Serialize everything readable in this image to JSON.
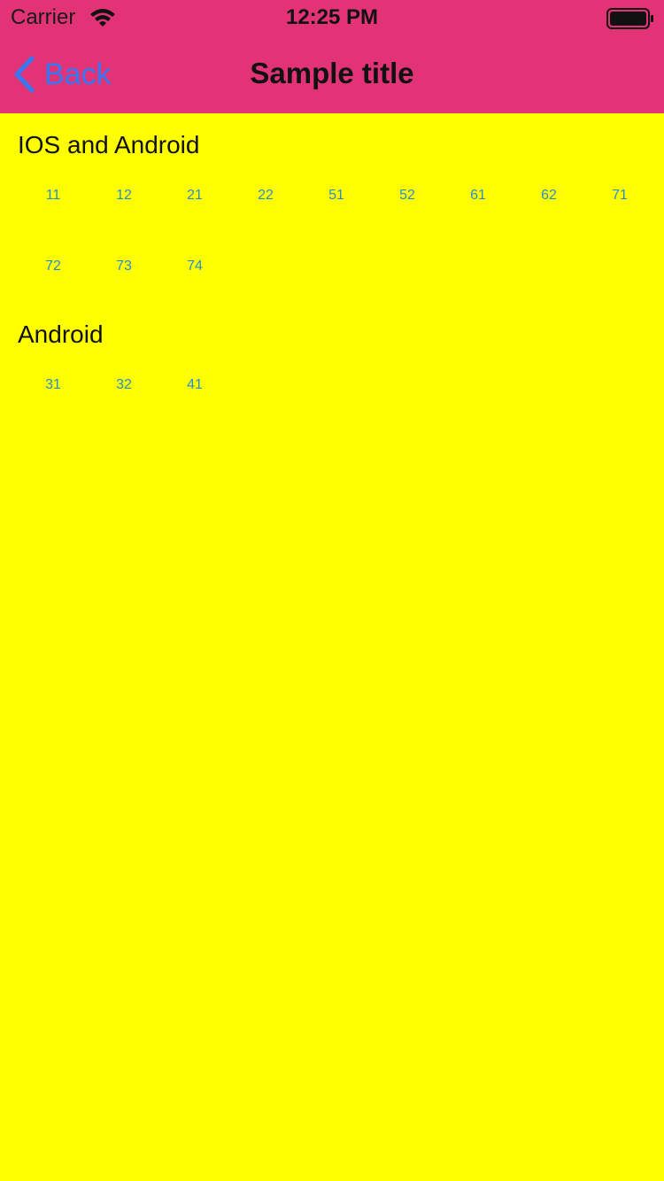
{
  "status_bar": {
    "carrier": "Carrier",
    "time": "12:25 PM",
    "icons": [
      "wifi-icon",
      "battery-icon"
    ]
  },
  "nav": {
    "back_label": "Back",
    "title": "Sample title"
  },
  "sections": [
    {
      "title": "IOS and Android",
      "items": [
        "11",
        "12",
        "21",
        "22",
        "51",
        "52",
        "61",
        "62",
        "71",
        "72",
        "73",
        "74"
      ]
    },
    {
      "title": "Android",
      "items": [
        "31",
        "32",
        "41"
      ]
    }
  ],
  "colors": {
    "header_bg": "#e23377",
    "page_bg": "#ffff00",
    "back_accent": "#3478f6",
    "item_text": "#2a8fc7"
  }
}
